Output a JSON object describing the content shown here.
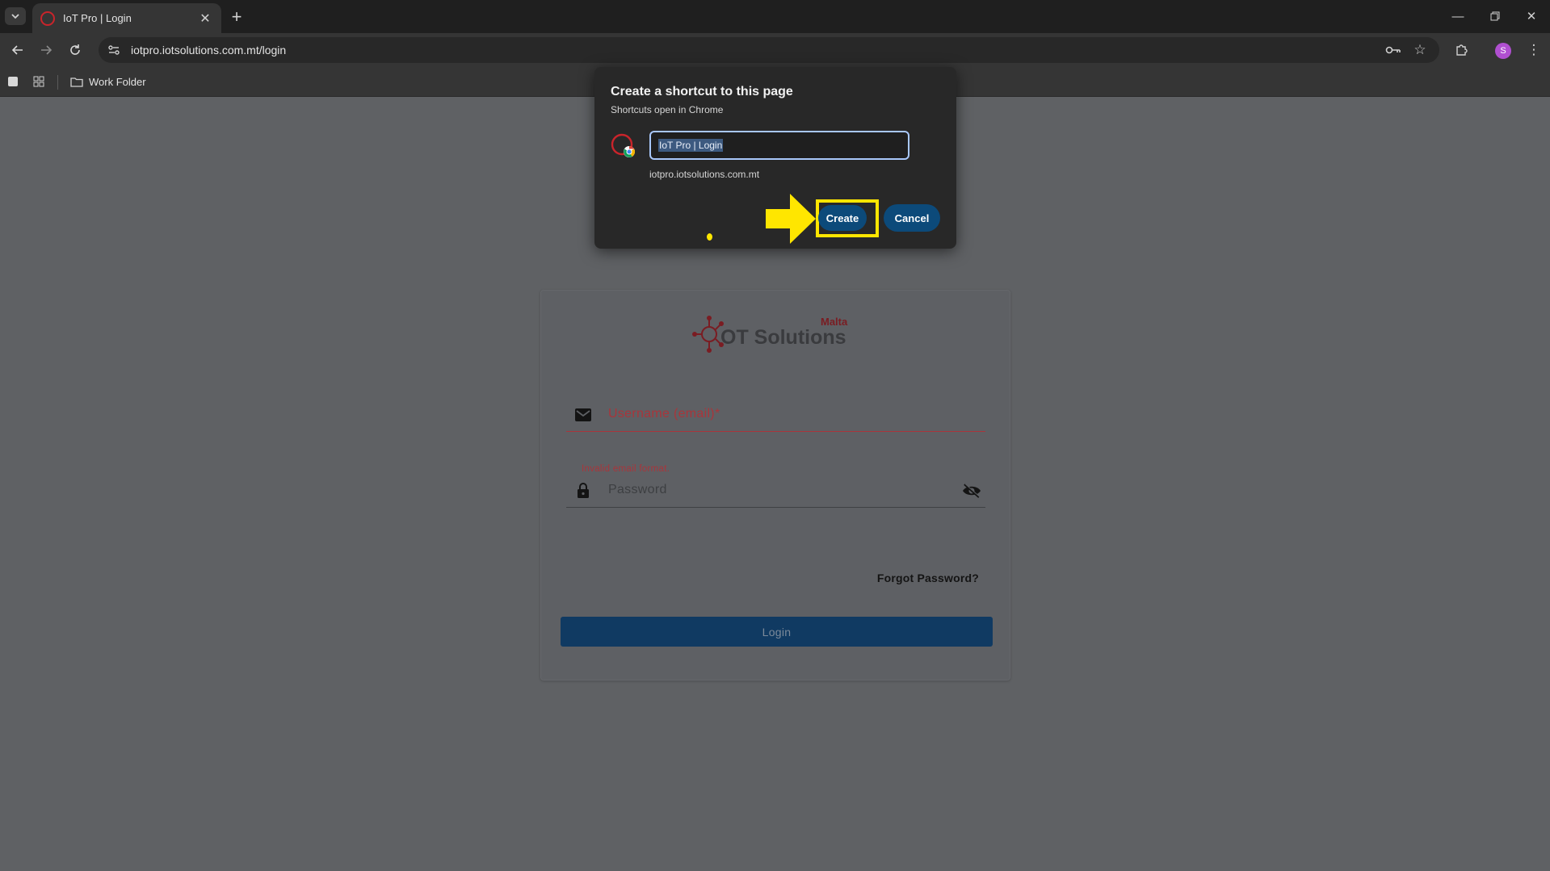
{
  "browser": {
    "tab_title": "IoT Pro | Login",
    "url": "iotpro.iotsolutions.com.mt/login",
    "avatar_letter": "S",
    "bookmark_folder": "Work Folder"
  },
  "dialog": {
    "title": "Create a shortcut to this page",
    "subtitle": "Shortcuts open in Chrome",
    "name_value": "IoT Pro | Login",
    "site": "iotpro.iotsolutions.com.mt",
    "create_label": "Create",
    "cancel_label": "Cancel",
    "highlight_color": "#ffe600"
  },
  "login": {
    "logo_text": "OT Solutions",
    "logo_sub": "Malta",
    "username_label": "Username (email)*",
    "username_error": "Invalid email format.",
    "password_label": "Password",
    "forgot_label": "Forgot Password?",
    "login_label": "Login"
  },
  "colors": {
    "brand_red": "#a9353b",
    "primary_blue": "#103a62",
    "accent": "#a8c7fa"
  }
}
